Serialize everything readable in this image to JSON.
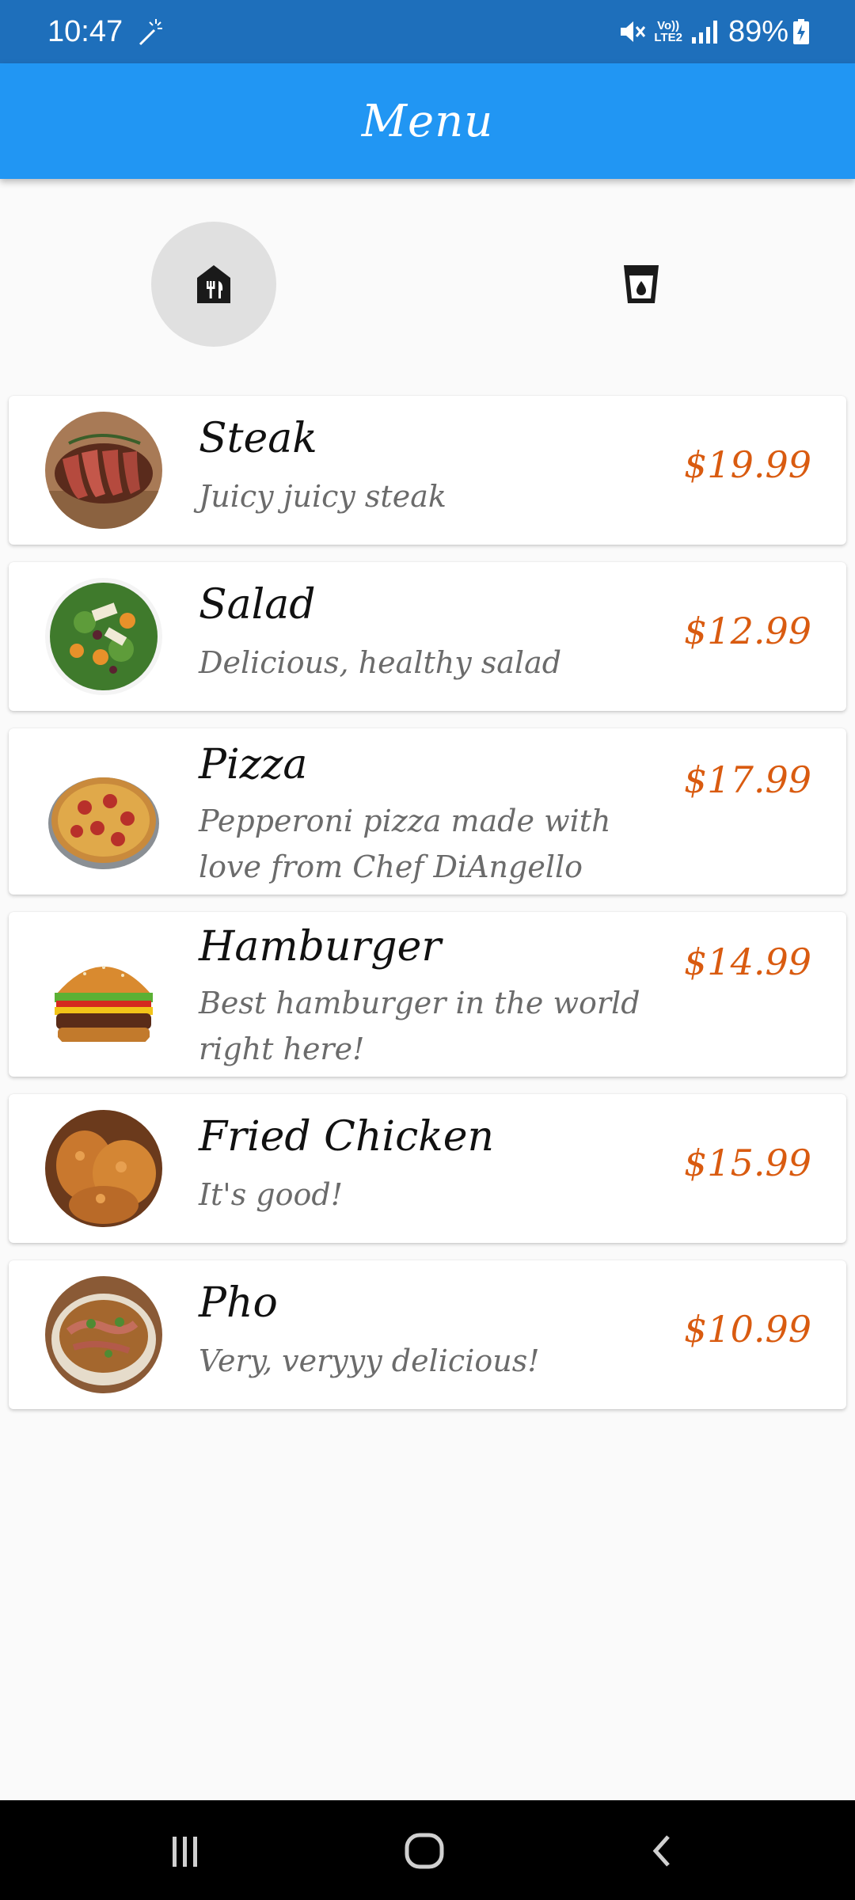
{
  "status_bar": {
    "time": "10:47",
    "network_label_top": "Vo))",
    "network_label_bottom": "LTE2",
    "battery": "89%"
  },
  "app_bar": {
    "title": "Menu"
  },
  "tabs": [
    {
      "name": "food",
      "icon": "restaurant-house-icon",
      "selected": true
    },
    {
      "name": "drinks",
      "icon": "drink-cup-icon",
      "selected": false
    }
  ],
  "menu": {
    "items": [
      {
        "name": "Steak",
        "description": "Juicy juicy steak",
        "price": "$19.99",
        "image_icon": "steak-image"
      },
      {
        "name": "Salad",
        "description": "Delicious, healthy salad",
        "price": "$12.99",
        "image_icon": "salad-image"
      },
      {
        "name": "Pizza",
        "description": "Pepperoni pizza made with love from Chef DiAngello",
        "price": "$17.99",
        "image_icon": "pizza-image"
      },
      {
        "name": "Hamburger",
        "description": "Best hamburger in the world right here!",
        "price": "$14.99",
        "image_icon": "hamburger-image"
      },
      {
        "name": "Fried Chicken",
        "description": "It's good!",
        "price": "$15.99",
        "image_icon": "fried-chicken-image"
      },
      {
        "name": "Pho",
        "description": "Very, veryyy delicious!",
        "price": "$10.99",
        "image_icon": "pho-image"
      }
    ]
  },
  "colors": {
    "status_bar": "#1e6fbb",
    "app_bar": "#2196f3",
    "price": "#d95b10",
    "background": "#fafafa"
  }
}
